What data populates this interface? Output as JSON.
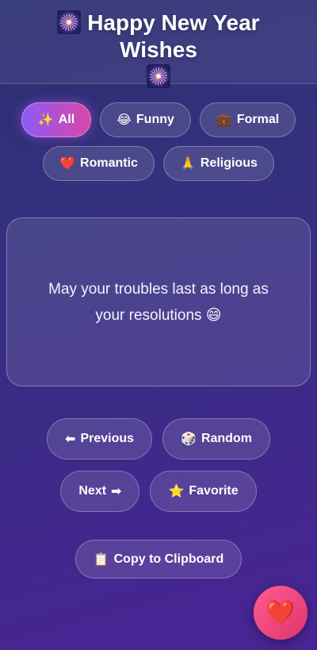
{
  "header": {
    "title": "Happy New Year Wishes",
    "icon": "fireworks-icon"
  },
  "filters": {
    "row1": [
      {
        "icon_glyph": "✨",
        "label": "All",
        "active": true
      },
      {
        "icon_glyph": "😂",
        "label": "Funny",
        "active": false
      },
      {
        "icon_glyph": "💼",
        "label": "Formal",
        "active": false
      }
    ],
    "row2": [
      {
        "icon_glyph": "❤️",
        "label": "Romantic",
        "active": false
      },
      {
        "icon_glyph": "🙏",
        "label": "Religious",
        "active": false
      }
    ]
  },
  "card": {
    "wish": "May your troubles last as long as your resolutions 😄"
  },
  "controls": {
    "previous": {
      "icon_glyph": "⬅",
      "label": "Previous"
    },
    "random": {
      "icon_glyph": "🎲",
      "label": "Random"
    },
    "next": {
      "icon_glyph": "➡",
      "label": "Next"
    },
    "favorite": {
      "icon_glyph": "⭐",
      "label": "Favorite"
    },
    "copy": {
      "icon_glyph": "📋",
      "label": "Copy to Clipboard"
    }
  },
  "fab": {
    "icon_glyph": "❤️"
  },
  "colors": {
    "accent_start": "#8b5cf6",
    "accent_end": "#d946a8",
    "fab": "#ff5d8f"
  }
}
